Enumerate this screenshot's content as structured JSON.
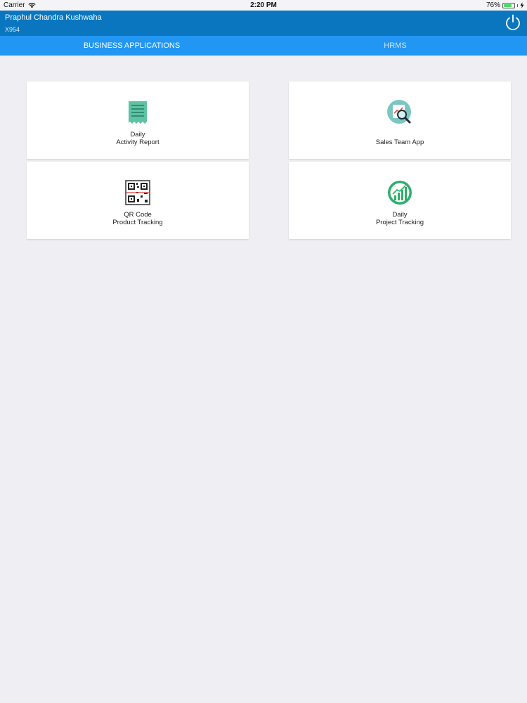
{
  "status_bar": {
    "carrier": "Carrier",
    "time": "2:20 PM",
    "battery": "76%",
    "battery_level": 0.76
  },
  "header": {
    "user_name": "Praphul Chandra Kushwaha",
    "user_id": "X954",
    "power_icon": "power-icon"
  },
  "tabs": [
    {
      "label": "BUSINESS APPLICATIONS",
      "active": true
    },
    {
      "label": "HRMS",
      "active": false
    }
  ],
  "apps": [
    {
      "line1": "Daily",
      "line2": "Activity Report",
      "icon": "receipt-icon"
    },
    {
      "line1": "Sales Team App",
      "line2": "",
      "icon": "sales-analytics-icon"
    },
    {
      "line1": "QR Code",
      "line2": "Product Tracking",
      "icon": "qr-code-icon"
    },
    {
      "line1": "Daily",
      "line2": "Project Tracking",
      "icon": "growth-chart-icon"
    }
  ],
  "colors": {
    "header": "#0a76bf",
    "tab_bar": "#2196f3",
    "background": "#eeeef3"
  }
}
